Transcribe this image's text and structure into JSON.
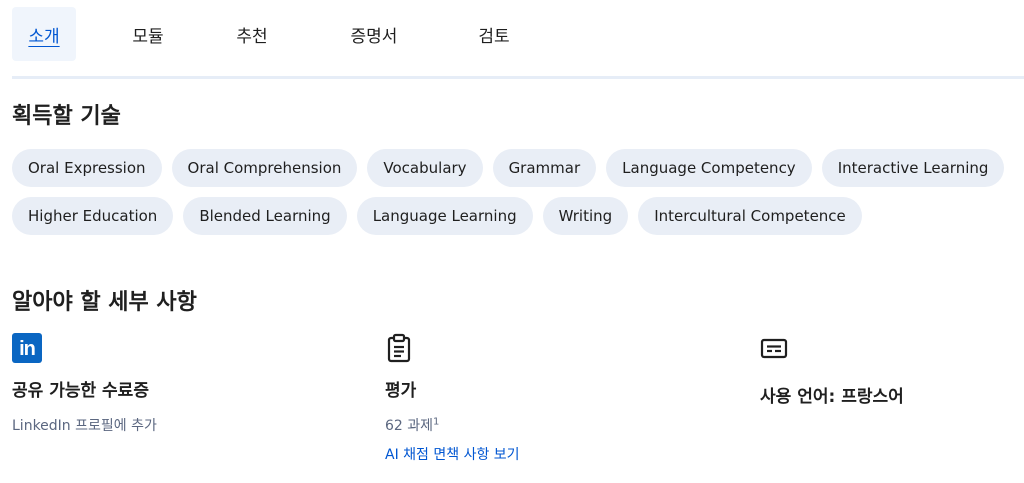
{
  "tabs": [
    {
      "label": "소개",
      "active": true
    },
    {
      "label": "모듈",
      "active": false
    },
    {
      "label": "추천",
      "active": false
    },
    {
      "label": "증명서",
      "active": false
    },
    {
      "label": "검토",
      "active": false
    }
  ],
  "skills": {
    "title": "획득할 기술",
    "items": [
      "Oral Expression",
      "Oral Comprehension",
      "Vocabulary",
      "Grammar",
      "Language Competency",
      "Interactive Learning",
      "Higher Education",
      "Blended Learning",
      "Language Learning",
      "Writing",
      "Intercultural Competence"
    ]
  },
  "details": {
    "title": "알아야 할 세부 사항",
    "certificate": {
      "icon": "linkedin-icon",
      "icon_text": "in",
      "title": "공유 가능한 수료증",
      "subtitle": "LinkedIn 프로필에 추가"
    },
    "assessment": {
      "icon": "clipboard-icon",
      "title": "평가",
      "subtitle": "62 과제",
      "footnote": "1",
      "link": "AI 채점 면책 사항 보기"
    },
    "language": {
      "icon": "subtitles-icon",
      "title": "사용 언어: 프랑스어"
    }
  },
  "colors": {
    "accent": "#0056d2",
    "linkedin": "#0a66c2",
    "chip_bg": "#e9eef6",
    "active_tab_bg": "#f0f5fc"
  }
}
